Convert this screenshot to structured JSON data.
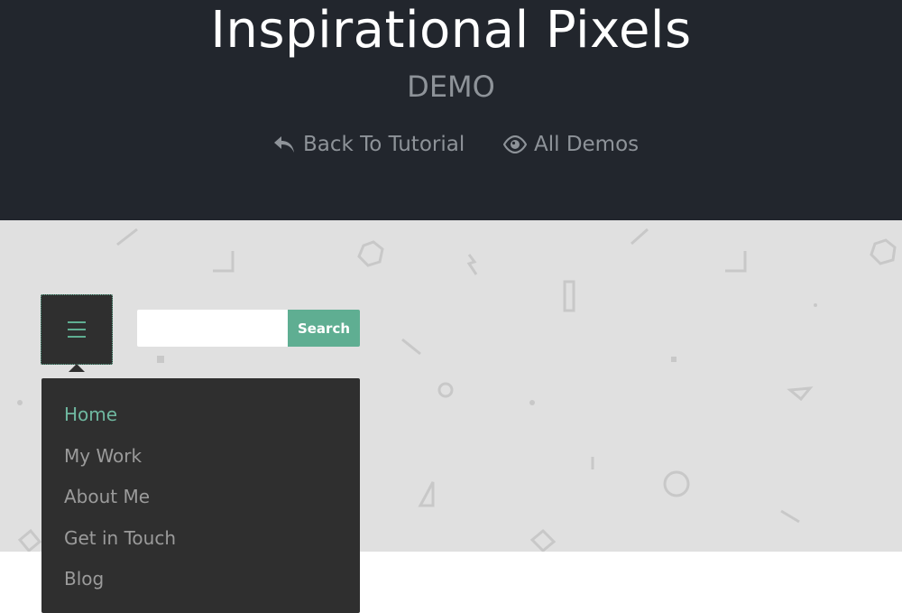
{
  "header": {
    "title": "Inspirational Pixels",
    "subtitle": "DEMO",
    "links": [
      {
        "label": "Back To Tutorial",
        "icon": "reply-arrow-icon"
      },
      {
        "label": "All Demos",
        "icon": "eye-icon"
      }
    ]
  },
  "toolbar": {
    "menu_icon": "hamburger-icon",
    "search": {
      "value": "",
      "placeholder": "",
      "button_label": "Search"
    }
  },
  "menu": {
    "items": [
      {
        "label": "Home",
        "active": true
      },
      {
        "label": "My Work",
        "active": false
      },
      {
        "label": "About Me",
        "active": false
      },
      {
        "label": "Get in Touch",
        "active": false
      },
      {
        "label": "Blog",
        "active": false
      }
    ]
  },
  "colors": {
    "header_bg": "#22262d",
    "hero_bg": "#e0e0e0",
    "accent": "#5fae92",
    "menu_bg": "#2f2f2f",
    "muted_text": "#8e9399"
  }
}
